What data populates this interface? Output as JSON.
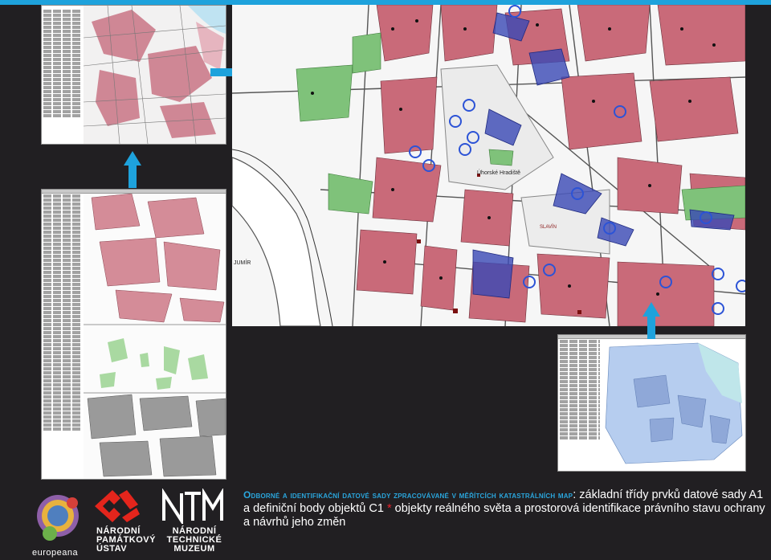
{
  "caption": {
    "heading": "Odborné a identifikační datové sady zpracovávané v měřítcích katastrálních map",
    "body_part1": ": základní třídy prvků datové sady A1 a definiční body objektů C1",
    "star": "*",
    "body_part2": " objekty reálného světa a prostorová identifikace právního stavu ochrany a návrhů jeho změn"
  },
  "map_labels": {
    "square": "Úhorské Hradiště",
    "place_a": "JUMÍR",
    "place_b": "SLAVÍN"
  },
  "logos": {
    "europeana": "europeana",
    "npu_line1": "NÁRODNÍ",
    "npu_line2": "PAMÁTKOVÝ",
    "npu_line3": "ÚSTAV",
    "ntm_line1": "NÁRODNÍ",
    "ntm_line2": "TECHNICKÉ",
    "ntm_line3": "MUZEUM"
  },
  "colors": {
    "background": "#211f22",
    "accent_blue": "#1ea2dc",
    "caption_heading": "#2aa6dd",
    "star_red": "#e8202a",
    "parcel_red": "#c96a79",
    "parcel_green": "#7fc27a",
    "highlight_blue": "#3a48b5"
  }
}
